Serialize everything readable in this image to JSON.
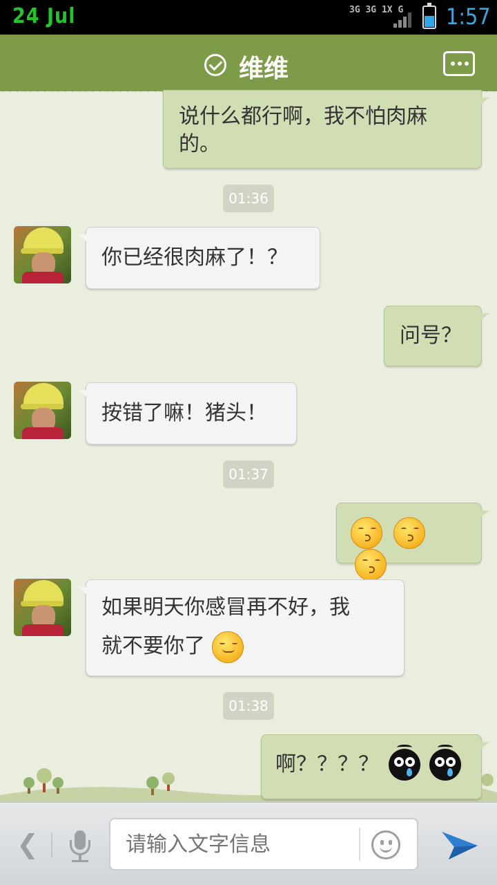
{
  "status_bar": {
    "date": "24  Jul",
    "network": "3G 3G 1X G",
    "time": "1:57",
    "battery_level": 0.55
  },
  "header": {
    "contact_name": "维维",
    "verified_icon": "check-circle-icon",
    "menu_icon": "chat-more-icon"
  },
  "messages": [
    {
      "type": "out",
      "text_line1": "说什么都行啊，我不怕肉麻",
      "text_line2": "的。"
    },
    {
      "type": "time",
      "text": "01:36"
    },
    {
      "type": "in",
      "text": "你已经很肉麻了！？"
    },
    {
      "type": "out",
      "text": "问号？"
    },
    {
      "type": "in",
      "text": "按错了嘛！猪头！"
    },
    {
      "type": "time",
      "text": "01:37"
    },
    {
      "type": "out",
      "emojis": [
        "kiss-emoji",
        "kiss-emoji",
        "kiss-emoji"
      ]
    },
    {
      "type": "in",
      "text_line1": "如果明天你感冒再不好，我",
      "text_line2": "就不要你了",
      "emoji": "smile-emoji"
    },
    {
      "type": "time",
      "text": "01:38"
    },
    {
      "type": "out",
      "text": "啊？？？？",
      "emojis": [
        "crying-bug-emoji",
        "crying-bug-emoji"
      ]
    }
  ],
  "input_bar": {
    "placeholder": "请输入文字信息",
    "back_icon": "chevron-left-icon",
    "mic_icon": "microphone-icon",
    "emoji_icon": "smiley-icon",
    "send_icon": "paper-plane-icon"
  },
  "colors": {
    "header": "#7d9b48",
    "outgoing_bubble": "#d1deb4",
    "incoming_bubble": "#f4f4f4",
    "background": "#e9eedf",
    "send_accent": "#2f7fd0"
  }
}
